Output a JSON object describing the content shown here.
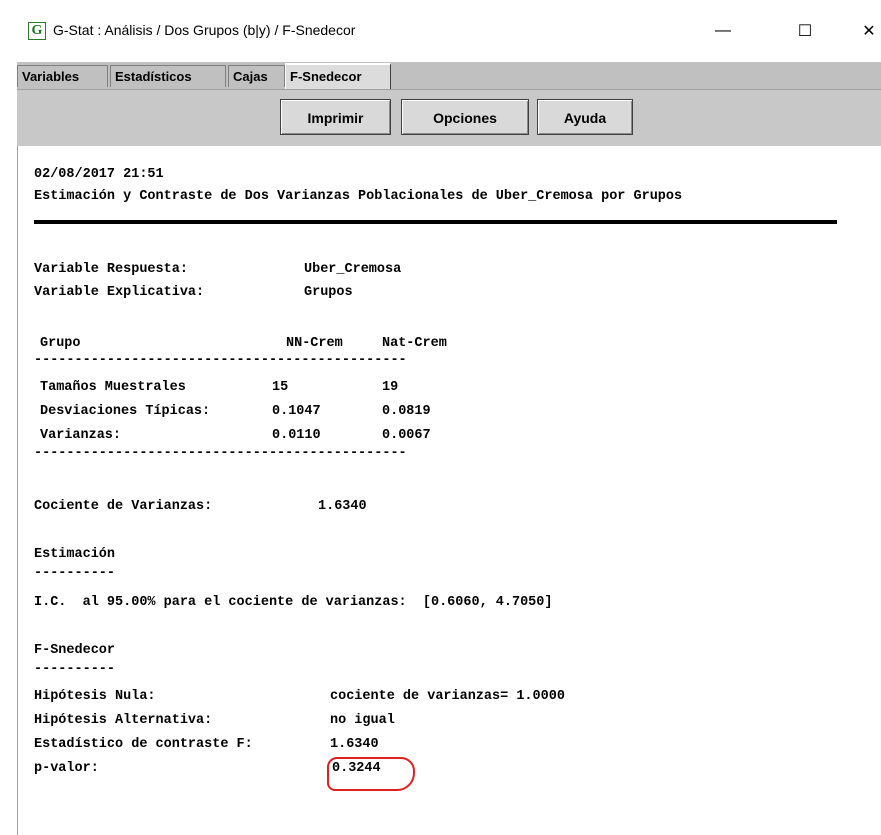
{
  "window": {
    "title": "G-Stat : Análisis / Dos Grupos (b|y) / F-Snedecor",
    "app_icon_letter": "G",
    "controls": {
      "minimize": "—",
      "maximize": "☐",
      "close": "✕"
    }
  },
  "tabs": [
    {
      "label": "Variables"
    },
    {
      "label": "Estadísticos"
    },
    {
      "label": "Cajas"
    },
    {
      "label": "F-Snedecor"
    }
  ],
  "toolbar": {
    "print_label": "Imprimir",
    "options_label": "Opciones",
    "help_label": "Ayuda"
  },
  "report": {
    "timestamp": "02/08/2017 21:51",
    "heading": "Estimación y Contraste de Dos Varianzas Poblacionales de Uber_Cremosa por Grupos",
    "response_label": "Variable Respuesta:",
    "response_value": "Uber_Cremosa",
    "explanatory_label": "Variable Explicativa:",
    "explanatory_value": "Grupos",
    "table": {
      "header": {
        "col0": "Grupo",
        "col1": "NN-Crem",
        "col2": "Nat-Crem"
      },
      "separator": "----------------------------------------------",
      "rows": [
        {
          "label": "Tamaños Muestrales",
          "v1": "15",
          "v2": "19"
        },
        {
          "label": "Desviaciones Típicas:",
          "v1": "0.1047",
          "v2": "0.0819"
        },
        {
          "label": "Varianzas:",
          "v1": "0.0110",
          "v2": "0.0067"
        }
      ]
    },
    "ratio_label": "Cociente de Varianzas:",
    "ratio_value": "1.6340",
    "estimation_title": "Estimación",
    "estimation_underline": "----------",
    "ci_line": "I.C.  al 95.00% para el cociente de varianzas:  [0.6060, 4.7050]",
    "test_title": "F-Snedecor",
    "test_underline": "----------",
    "null_label": "Hipótesis Nula:",
    "null_value": "cociente de varianzas= 1.0000",
    "alt_label": "Hipótesis Alternativa:",
    "alt_value": "no igual",
    "stat_label": "Estadístico de contraste F:",
    "stat_value": "1.6340",
    "pvalue_label": "p-valor:",
    "pvalue_value": "0.3244",
    "annotation_color": "#e02020"
  }
}
